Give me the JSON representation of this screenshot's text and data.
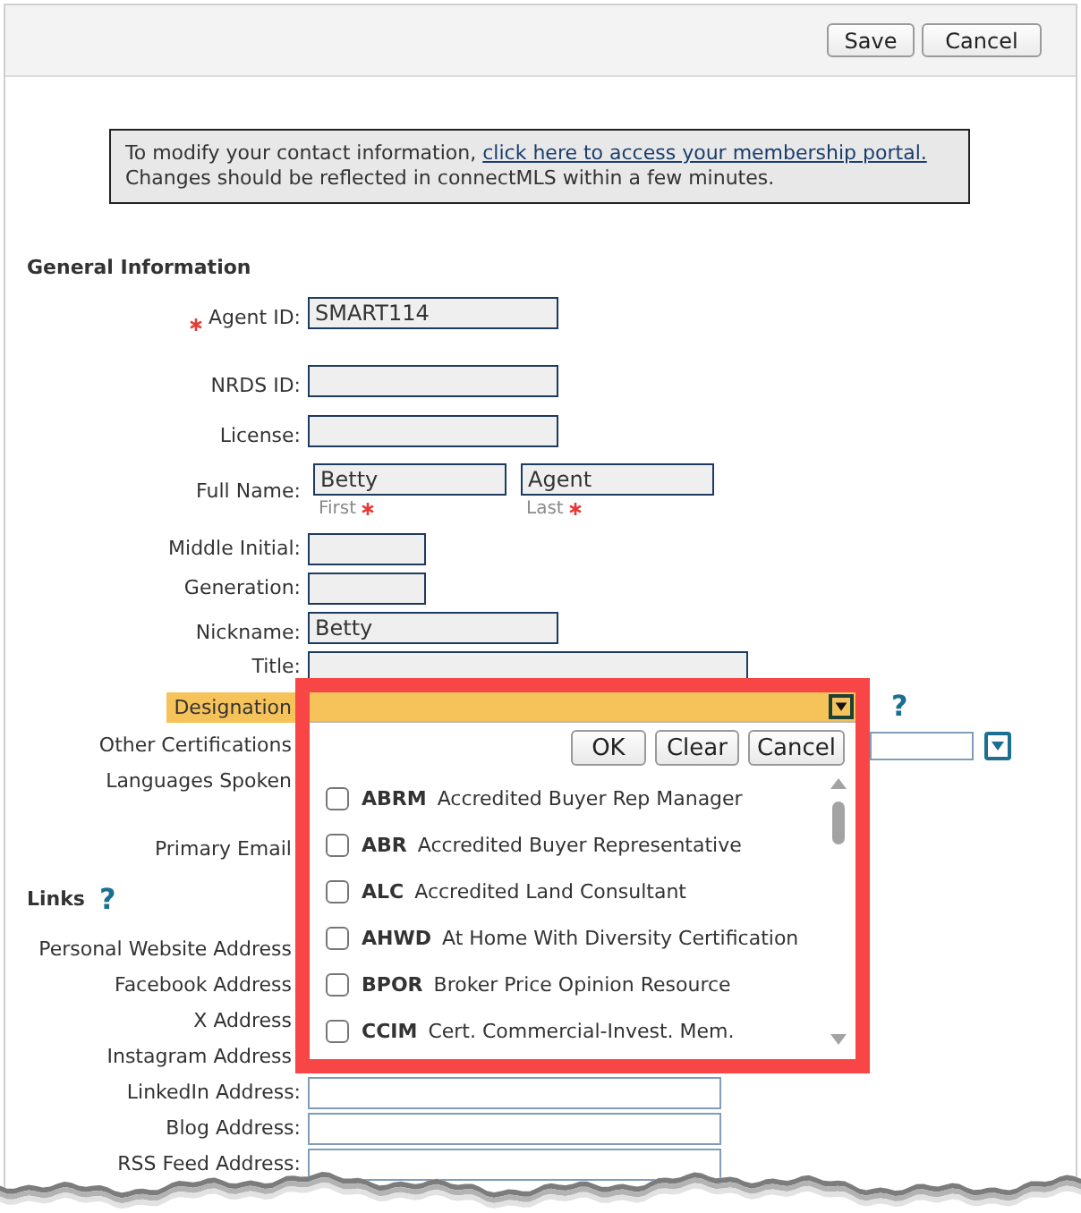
{
  "toolbar": {
    "buttons": [
      "Save",
      "Cancel"
    ]
  },
  "notice": {
    "text": "To modify your contact information,",
    "link": "click here to access your membership portal.",
    "note": "Changes should be reflected in connectMLS within a few minutes."
  },
  "general_information": {
    "title": "General Information",
    "fields": [
      {
        "kind": "field",
        "label": "Agent ID:",
        "required": true,
        "active": false,
        "value": "SMART114"
      },
      {
        "kind": "field",
        "label": "NRDS ID:",
        "required": false,
        "active": false
      },
      {
        "kind": "field",
        "label": "License:",
        "required": false,
        "active": false
      },
      {
        "kind": "name",
        "label": "Full Name:",
        "required": false,
        "active": false,
        "parts": [
          {
            "value": "Betty",
            "caption": "First",
            "required": true
          },
          {
            "value": "Agent",
            "caption": "Last",
            "required": true
          }
        ]
      },
      {
        "kind": "short",
        "label": "Middle Initial:",
        "required": false,
        "active": false
      },
      {
        "kind": "short",
        "label": "Generation:",
        "required": false,
        "active": false
      },
      {
        "kind": "field",
        "label": "Nickname:",
        "required": false,
        "active": false,
        "value": "Betty"
      },
      {
        "kind": "wide",
        "label": "Title:",
        "required": false,
        "active": false
      },
      {
        "kind": "picker",
        "label": "Designation",
        "required": false,
        "active": true,
        "help": "?"
      },
      {
        "kind": "dropdown",
        "label": "Other Certifications",
        "required": false,
        "active": false
      },
      {
        "kind": "covered",
        "label": "Languages Spoken",
        "required": false,
        "active": false
      },
      {
        "kind": "covered",
        "label": "Primary Email",
        "required": false,
        "active": false
      }
    ]
  },
  "links": {
    "title": "Links",
    "help": "?",
    "fields": [
      {
        "kind": "covered",
        "label": "Personal Website Address"
      },
      {
        "kind": "covered",
        "label": "Facebook Address"
      },
      {
        "kind": "covered",
        "label": "X Address"
      },
      {
        "kind": "covered",
        "label": "Instagram Address"
      },
      {
        "kind": "field",
        "label": "LinkedIn Address:"
      },
      {
        "kind": "field",
        "label": "Blog Address:"
      },
      {
        "kind": "field",
        "label": "RSS Feed Address:"
      }
    ]
  },
  "designation_picker": {
    "buttons": [
      "OK",
      "Clear",
      "Cancel"
    ],
    "options": [
      {
        "code": "ABRM",
        "name": "Accredited Buyer Rep Manager",
        "checked": false
      },
      {
        "code": "ABR",
        "name": "Accredited Buyer Representative",
        "checked": false
      },
      {
        "code": "ALC",
        "name": "Accredited Land Consultant",
        "checked": false
      },
      {
        "code": "AHWD",
        "name": "At Home With Diversity Certification",
        "checked": false
      },
      {
        "code": "BPOR",
        "name": "Broker Price Opinion Resource",
        "checked": false
      },
      {
        "code": "CCIM",
        "name": "Cert. Commercial-Invest. Mem.",
        "checked": false
      }
    ]
  }
}
